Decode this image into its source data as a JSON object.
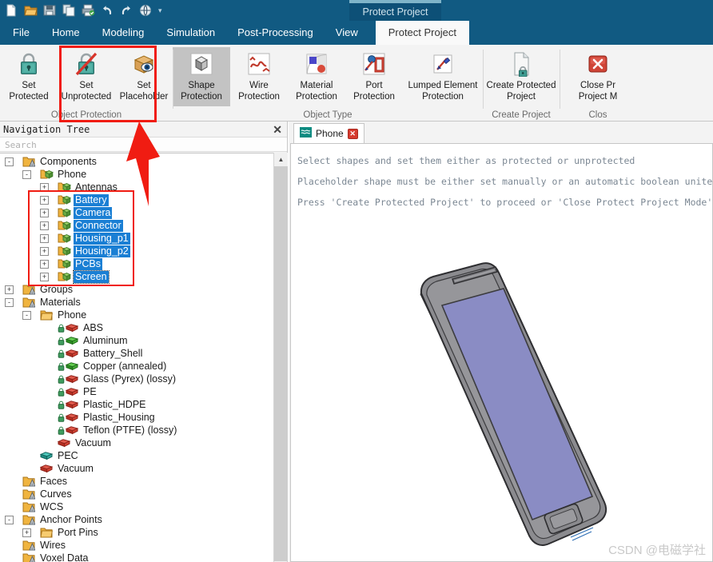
{
  "quick_access": {
    "items": [
      {
        "name": "new-icon",
        "tooltip": "New"
      },
      {
        "name": "open-icon",
        "tooltip": "Open"
      },
      {
        "name": "save-icon",
        "tooltip": "Save"
      },
      {
        "name": "copy-icon",
        "tooltip": "Copy"
      },
      {
        "name": "print-icon",
        "tooltip": "Print"
      },
      {
        "name": "undo-icon",
        "tooltip": "Undo"
      },
      {
        "name": "redo-icon",
        "tooltip": "Redo"
      },
      {
        "name": "macro-icon",
        "tooltip": "Macros"
      }
    ],
    "caret": "▾"
  },
  "contextual_group": {
    "label": "Protect Project"
  },
  "ribbon_tabs": {
    "items": [
      {
        "label": "File",
        "active": false
      },
      {
        "label": "Home",
        "active": false
      },
      {
        "label": "Modeling",
        "active": false
      },
      {
        "label": "Simulation",
        "active": false
      },
      {
        "label": "Post-Processing",
        "active": false
      },
      {
        "label": "View",
        "active": false
      },
      {
        "label": "Protect Project",
        "active": true
      }
    ]
  },
  "ribbon": {
    "groups": [
      {
        "label": "Object Protection",
        "buttons": [
          {
            "label": "Set\nProtected",
            "icon": "lock-closed-icon",
            "selected": false
          },
          {
            "label": "Set\nUnprotected",
            "icon": "lock-unprotected-icon",
            "selected": false
          },
          {
            "label": "Set\nPlaceholder",
            "icon": "placeholder-box-eye-icon",
            "selected": false
          }
        ]
      },
      {
        "label": "Object Type",
        "buttons": [
          {
            "label": "Shape\nProtection",
            "icon": "shape-cube-icon",
            "selected": true
          },
          {
            "label": "Wire\nProtection",
            "icon": "wire-curve-icon",
            "selected": false
          },
          {
            "label": "Material\nProtection",
            "icon": "material-icon",
            "selected": false
          },
          {
            "label": "Port\nProtection",
            "icon": "port-door-icon",
            "selected": false
          },
          {
            "label": "Lumped Element\nProtection",
            "icon": "lumped-element-icon",
            "selected": false
          }
        ]
      },
      {
        "label": "Create Project",
        "buttons": [
          {
            "label": "Create Protected\nProject",
            "icon": "document-lock-icon",
            "selected": false
          }
        ]
      },
      {
        "label": "Clos",
        "buttons": [
          {
            "label": "Close Pr\nProject M",
            "icon": "close-red-x-icon",
            "selected": false
          }
        ]
      }
    ]
  },
  "navigation_panel": {
    "title": "Navigation Tree",
    "close_label": "✕",
    "search": {
      "value": "",
      "placeholder": "Search"
    },
    "scrollbar": {
      "up_arrow": "▲"
    },
    "tree": [
      {
        "label": "Components",
        "depth": 0,
        "expander": "-",
        "icon": "folder-group-icon",
        "selected": false
      },
      {
        "label": "Phone",
        "depth": 1,
        "expander": "-",
        "icon": "component-group-icon",
        "selected": false
      },
      {
        "label": "Antennas",
        "depth": 2,
        "expander": "+",
        "icon": "component-icon",
        "selected": false
      },
      {
        "label": "Battery",
        "depth": 2,
        "expander": "+",
        "icon": "component-icon",
        "selected": true
      },
      {
        "label": "Camera",
        "depth": 2,
        "expander": "+",
        "icon": "component-icon",
        "selected": true
      },
      {
        "label": "Connector",
        "depth": 2,
        "expander": "+",
        "icon": "component-icon",
        "selected": true
      },
      {
        "label": "Housing_p1",
        "depth": 2,
        "expander": "+",
        "icon": "component-icon",
        "selected": true
      },
      {
        "label": "Housing_p2",
        "depth": 2,
        "expander": "+",
        "icon": "component-icon",
        "selected": true
      },
      {
        "label": "PCBs",
        "depth": 2,
        "expander": "+",
        "icon": "component-icon",
        "selected": true
      },
      {
        "label": "Screen",
        "depth": 2,
        "expander": "+",
        "icon": "component-icon",
        "selected": true,
        "focus": true
      },
      {
        "label": "Groups",
        "depth": 0,
        "expander": "+",
        "icon": "folder-group-icon",
        "selected": false
      },
      {
        "label": "Materials",
        "depth": 0,
        "expander": "-",
        "icon": "folder-group-icon",
        "selected": false
      },
      {
        "label": "Phone",
        "depth": 1,
        "expander": "-",
        "icon": "folder-plain-icon",
        "selected": false
      },
      {
        "label": "ABS",
        "depth": 2,
        "expander": "",
        "icon": "material-red-icon",
        "lock": true,
        "selected": false
      },
      {
        "label": "Aluminum",
        "depth": 2,
        "expander": "",
        "icon": "material-green-icon",
        "lock": true,
        "selected": false
      },
      {
        "label": "Battery_Shell",
        "depth": 2,
        "expander": "",
        "icon": "material-red-icon",
        "lock": true,
        "selected": false
      },
      {
        "label": "Copper (annealed)",
        "depth": 2,
        "expander": "",
        "icon": "material-green-icon",
        "lock": true,
        "selected": false
      },
      {
        "label": "Glass (Pyrex) (lossy)",
        "depth": 2,
        "expander": "",
        "icon": "material-red-icon",
        "lock": true,
        "selected": false
      },
      {
        "label": "PE",
        "depth": 2,
        "expander": "",
        "icon": "material-red-icon",
        "lock": true,
        "selected": false
      },
      {
        "label": "Plastic_HDPE",
        "depth": 2,
        "expander": "",
        "icon": "material-red-icon",
        "lock": true,
        "selected": false
      },
      {
        "label": "Plastic_Housing",
        "depth": 2,
        "expander": "",
        "icon": "material-red-icon",
        "lock": true,
        "selected": false
      },
      {
        "label": "Teflon (PTFE) (lossy)",
        "depth": 2,
        "expander": "",
        "icon": "material-red-icon",
        "lock": true,
        "selected": false
      },
      {
        "label": "Vacuum",
        "depth": 2,
        "expander": "",
        "icon": "material-red-icon",
        "lock": false,
        "selected": false
      },
      {
        "label": "PEC",
        "depth": 1,
        "expander": "",
        "icon": "material-teal-icon",
        "lock": false,
        "selected": false
      },
      {
        "label": "Vacuum",
        "depth": 1,
        "expander": "",
        "icon": "material-red-icon",
        "lock": false,
        "selected": false
      },
      {
        "label": "Faces",
        "depth": 0,
        "expander": "",
        "icon": "folder-group-icon",
        "selected": false
      },
      {
        "label": "Curves",
        "depth": 0,
        "expander": "",
        "icon": "folder-group-icon",
        "selected": false
      },
      {
        "label": "WCS",
        "depth": 0,
        "expander": "",
        "icon": "folder-group-icon",
        "selected": false
      },
      {
        "label": "Anchor Points",
        "depth": 0,
        "expander": "-",
        "icon": "folder-group-icon",
        "selected": false
      },
      {
        "label": "Port Pins",
        "depth": 1,
        "expander": "+",
        "icon": "folder-plain-icon",
        "selected": false
      },
      {
        "label": "Wires",
        "depth": 0,
        "expander": "",
        "icon": "folder-group-icon",
        "selected": false
      },
      {
        "label": "Voxel Data",
        "depth": 0,
        "expander": "",
        "icon": "folder-group-icon",
        "selected": false
      }
    ]
  },
  "main_view": {
    "document_tab": {
      "label": "Phone",
      "icon": "project-icon",
      "close_label": "✕"
    },
    "hint_lines": [
      "Select shapes and set them either as protected or unprotected",
      "Placeholder shape must be either set manually or an automatic boolean unite o",
      "Press 'Create Protected Project' to proceed or 'Close Protect Project Mode' o"
    ],
    "model": {
      "name": "phone-3d-model",
      "screen_color": "#8a8cc4",
      "body_color": "#8a8a8e"
    },
    "watermark": "CSDN @电磁学社"
  },
  "annotations": {
    "ribbon_highlight": "set-unprotected-highlight",
    "tree_highlight": "selected-components-highlight",
    "arrow": "red-arrow-up"
  },
  "colors": {
    "ribbon_blue": "#115a82",
    "contextual_blue": "#0d5077",
    "contextual_accent": "#7fb4c9",
    "selection_blue": "#1a7fd4",
    "annotation_red": "#f01c12",
    "selected_button_gray": "#c3c3c3"
  }
}
